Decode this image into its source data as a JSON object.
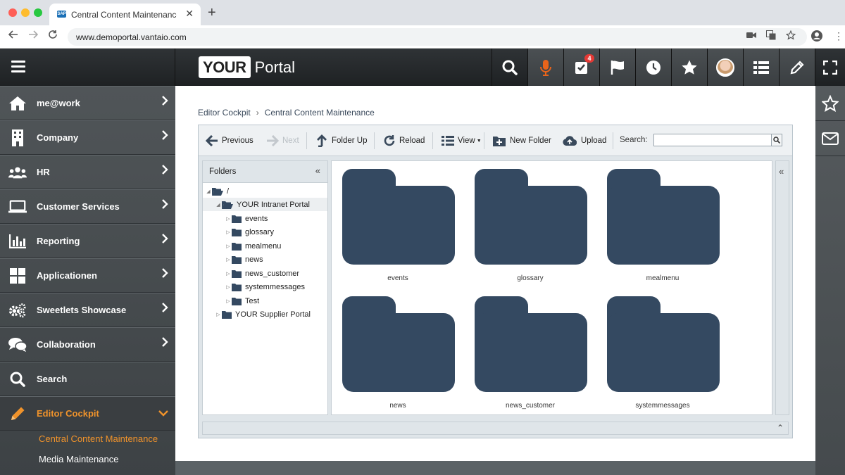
{
  "browser": {
    "tab_title": "Central Content Maintenance",
    "url": "www.demoportal.vantaio.com"
  },
  "header": {
    "logo_box": "YOUR",
    "logo_word": "Portal",
    "notifications_count": "4",
    "icons": [
      "search-icon",
      "microphone-icon",
      "tasks-icon",
      "flag-icon",
      "clock-icon",
      "star-icon",
      "avatar",
      "list-icon",
      "pencil-icon",
      "fullscreen-icon"
    ]
  },
  "sidebar": {
    "items": [
      {
        "label": "me@work",
        "icon": "home-icon"
      },
      {
        "label": "Company",
        "icon": "building-icon"
      },
      {
        "label": "HR",
        "icon": "people-icon"
      },
      {
        "label": "Customer Services",
        "icon": "laptop-icon"
      },
      {
        "label": "Reporting",
        "icon": "chart-icon"
      },
      {
        "label": "Applicationen",
        "icon": "grid-icon"
      },
      {
        "label": "Sweetlets Showcase",
        "icon": "gears-icon"
      },
      {
        "label": "Collaboration",
        "icon": "chat-icon"
      },
      {
        "label": "Search",
        "icon": "search-icon"
      },
      {
        "label": "Editor Cockpit",
        "icon": "pencil-icon",
        "active": true
      }
    ],
    "subitems": [
      {
        "label": "Central Content Maintenance",
        "active": true
      },
      {
        "label": "Media Maintenance",
        "active": false
      }
    ],
    "accent_color": "#f0932b"
  },
  "breadcrumb": {
    "root": "Editor Cockpit",
    "current": "Central Content Maintenance"
  },
  "toolbar": {
    "previous": "Previous",
    "next": "Next",
    "folder_up": "Folder Up",
    "reload": "Reload",
    "view": "View",
    "new_folder": "New Folder",
    "upload": "Upload",
    "search_label": "Search:",
    "search_value": ""
  },
  "folders_panel": {
    "title": "Folders",
    "tree": [
      {
        "label": "/",
        "level": 0,
        "expanded": true
      },
      {
        "label": "YOUR Intranet Portal",
        "level": 1,
        "expanded": true,
        "selected": true
      },
      {
        "label": "events",
        "level": 2
      },
      {
        "label": "glossary",
        "level": 2
      },
      {
        "label": "mealmenu",
        "level": 2
      },
      {
        "label": "news",
        "level": 2
      },
      {
        "label": "news_customer",
        "level": 2
      },
      {
        "label": "systemmessages",
        "level": 2
      },
      {
        "label": "Test",
        "level": 2
      },
      {
        "label": "YOUR Supplier Portal",
        "level": 1,
        "expanded": false
      }
    ]
  },
  "grid": {
    "tiles": [
      "events",
      "glossary",
      "mealmenu",
      "news",
      "news_customer",
      "systemmessages"
    ],
    "folder_color": "#344961"
  }
}
